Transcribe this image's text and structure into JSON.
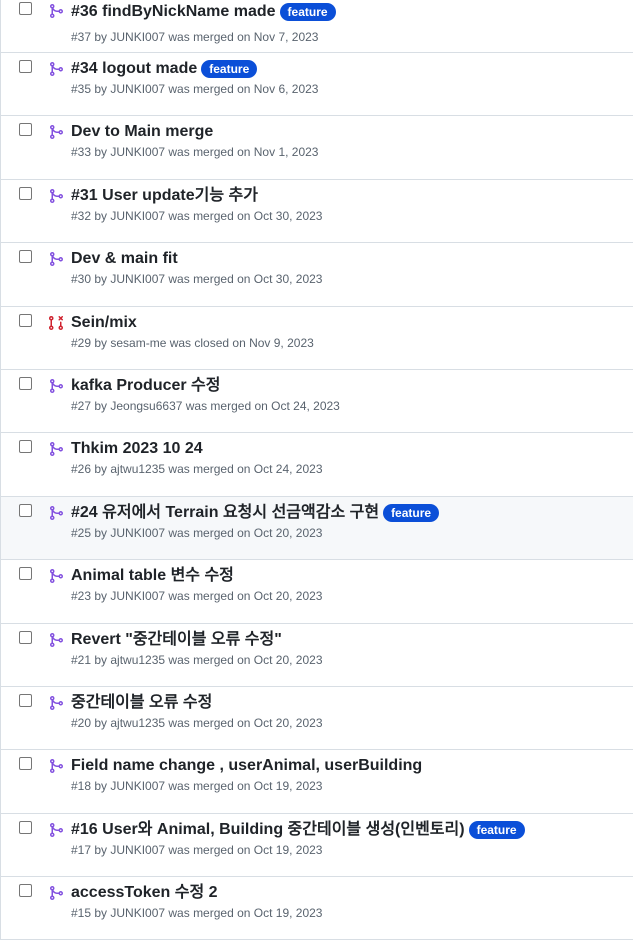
{
  "colors": {
    "merged": "#8250df",
    "closed": "#cf222e",
    "label_bg": "#0b4fd8",
    "label_text": "#ffffff",
    "meta": "#59636e",
    "divider": "#d8dee4"
  },
  "pull_requests": [
    {
      "title": "#36 findByNickName made",
      "label": "feature",
      "meta": "#37 by JUNKI007 was merged on Nov 7, 2023",
      "state": "merged",
      "icon": "merged-icon"
    },
    {
      "title": "#34 logout made",
      "label": "feature",
      "meta": "#35 by JUNKI007 was merged on Nov 6, 2023",
      "state": "merged",
      "icon": "merged-icon"
    },
    {
      "title": "Dev to Main merge",
      "label": "",
      "meta": "#33 by JUNKI007 was merged on Nov 1, 2023",
      "state": "merged",
      "icon": "merged-icon"
    },
    {
      "title": "#31 User update기능 추가",
      "label": "",
      "meta": "#32 by JUNKI007 was merged on Oct 30, 2023",
      "state": "merged",
      "icon": "merged-icon"
    },
    {
      "title": "Dev & main fit",
      "label": "",
      "meta": "#30 by JUNKI007 was merged on Oct 30, 2023",
      "state": "merged",
      "icon": "merged-icon"
    },
    {
      "title": "Sein/mix",
      "label": "",
      "meta": "#29 by sesam-me was closed on Nov 9, 2023",
      "state": "closed",
      "icon": "closed-pr-icon"
    },
    {
      "title": "kafka Producer 수정",
      "label": "",
      "meta": "#27 by Jeongsu6637 was merged on Oct 24, 2023",
      "state": "merged",
      "icon": "merged-icon"
    },
    {
      "title": "Thkim 2023 10 24",
      "label": "",
      "meta": "#26 by ajtwu1235 was merged on Oct 24, 2023",
      "state": "merged",
      "icon": "merged-icon"
    },
    {
      "title": "#24 유저에서 Terrain 요청시 선금액감소 구현",
      "label": "feature",
      "meta": "#25 by JUNKI007 was merged on Oct 20, 2023",
      "state": "merged",
      "icon": "merged-icon",
      "hover": true
    },
    {
      "title": "Animal table 변수 수정",
      "label": "",
      "meta": "#23 by JUNKI007 was merged on Oct 20, 2023",
      "state": "merged",
      "icon": "merged-icon"
    },
    {
      "title": "Revert \"중간테이블 오류 수정\"",
      "label": "",
      "meta": "#21 by ajtwu1235 was merged on Oct 20, 2023",
      "state": "merged",
      "icon": "merged-icon"
    },
    {
      "title": "중간테이블 오류 수정",
      "label": "",
      "meta": "#20 by ajtwu1235 was merged on Oct 20, 2023",
      "state": "merged",
      "icon": "merged-icon"
    },
    {
      "title": "Field name change , userAnimal, userBuilding",
      "label": "",
      "meta": "#18 by JUNKI007 was merged on Oct 19, 2023",
      "state": "merged",
      "icon": "merged-icon"
    },
    {
      "title": "#16 User와 Animal, Building 중간테이블 생성(인벤토리)",
      "label": "feature",
      "meta": "#17 by JUNKI007 was merged on Oct 19, 2023",
      "state": "merged",
      "icon": "merged-icon"
    },
    {
      "title": "accessToken 수정 2",
      "label": "",
      "meta": "#15 by JUNKI007 was merged on Oct 19, 2023",
      "state": "merged",
      "icon": "merged-icon"
    }
  ]
}
